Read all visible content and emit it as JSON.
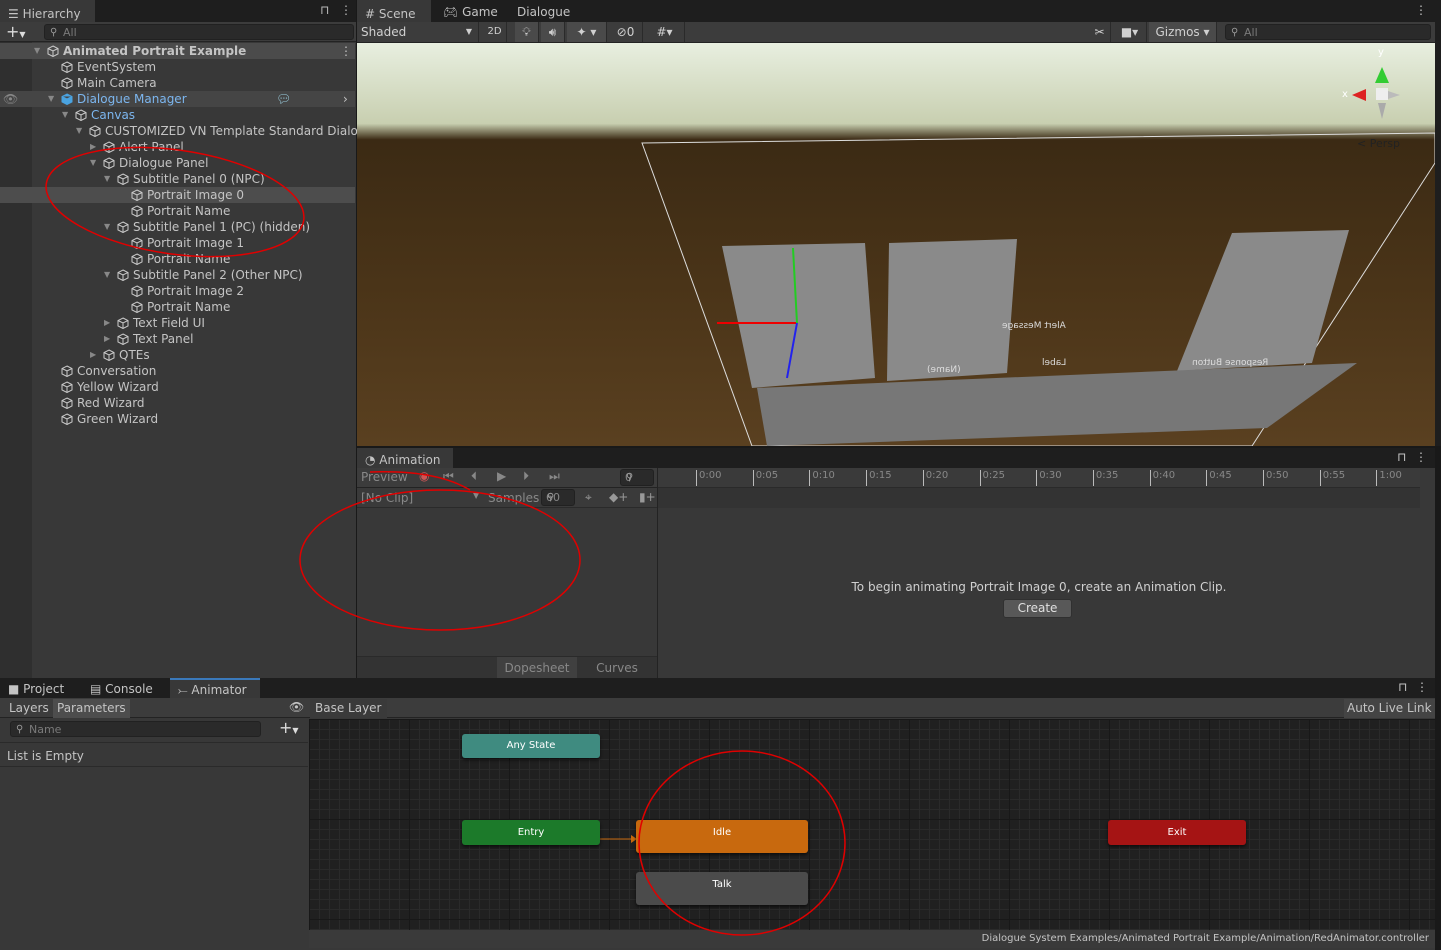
{
  "hierarchy": {
    "tab": "Hierarchy",
    "search_placeholder": "All",
    "items": [
      {
        "label": "Animated Portrait Example",
        "level": 0,
        "expanded": true,
        "icon": "unity-scene-icon"
      },
      {
        "label": "EventSystem",
        "level": 1,
        "icon": "gameobject-cube-icon"
      },
      {
        "label": "Main Camera",
        "level": 1,
        "icon": "gameobject-cube-icon"
      },
      {
        "label": "Dialogue Manager",
        "level": 1,
        "expanded": true,
        "icon": "prefab-cube-icon",
        "prefab": true
      },
      {
        "label": "Canvas",
        "level": 2,
        "expanded": true,
        "icon": "gameobject-cube-icon",
        "prefab": true
      },
      {
        "label": "CUSTOMIZED VN Template Standard Dialogue UI",
        "level": 3,
        "expanded": true,
        "icon": "gameobject-cube-icon"
      },
      {
        "label": "Alert Panel",
        "level": 4,
        "expanded": false,
        "icon": "gameobject-cube-icon"
      },
      {
        "label": "Dialogue Panel",
        "level": 4,
        "expanded": true,
        "icon": "gameobject-cube-icon"
      },
      {
        "label": "Subtitle Panel 0 (NPC)",
        "level": 5,
        "expanded": true,
        "icon": "gameobject-cube-icon"
      },
      {
        "label": "Portrait Image 0",
        "level": 6,
        "icon": "gameobject-cube-icon",
        "selected": true
      },
      {
        "label": "Portrait Name",
        "level": 6,
        "icon": "gameobject-cube-icon"
      },
      {
        "label": "Subtitle Panel 1 (PC) (hidden)",
        "level": 5,
        "expanded": true,
        "icon": "gameobject-cube-icon"
      },
      {
        "label": "Portrait Image 1",
        "level": 6,
        "icon": "gameobject-cube-icon"
      },
      {
        "label": "Portrait Name",
        "level": 6,
        "icon": "gameobject-cube-icon"
      },
      {
        "label": "Subtitle Panel 2 (Other NPC)",
        "level": 5,
        "expanded": true,
        "icon": "gameobject-cube-icon"
      },
      {
        "label": "Portrait Image 2",
        "level": 6,
        "icon": "gameobject-cube-icon"
      },
      {
        "label": "Portrait Name",
        "level": 6,
        "icon": "gameobject-cube-icon"
      },
      {
        "label": "Text Field UI",
        "level": 5,
        "expanded": false,
        "icon": "gameobject-cube-icon"
      },
      {
        "label": "Text Panel",
        "level": 5,
        "expanded": false,
        "icon": "gameobject-cube-icon"
      },
      {
        "label": "QTEs",
        "level": 4,
        "expanded": false,
        "icon": "gameobject-cube-icon"
      },
      {
        "label": "Conversation",
        "level": 1,
        "icon": "gameobject-cube-icon"
      },
      {
        "label": "Yellow Wizard",
        "level": 1,
        "icon": "gameobject-cube-icon"
      },
      {
        "label": "Red Wizard",
        "level": 1,
        "icon": "gameobject-cube-icon"
      },
      {
        "label": "Green Wizard",
        "level": 1,
        "icon": "gameobject-cube-icon"
      }
    ]
  },
  "scene": {
    "tabs": [
      "Scene",
      "Game",
      "Dialogue"
    ],
    "shading": "Shaded",
    "mode_2d": "2D",
    "hidden_count": "0",
    "gizmos": "Gizmos",
    "search_placeholder": "All",
    "projection": "Persp",
    "axis_x": "x",
    "axis_y": "y",
    "scene_labels": [
      "Alert Message",
      "Label",
      "(Name)",
      "Response Button"
    ]
  },
  "animation": {
    "tab": "Animation",
    "preview": "Preview",
    "frame": "0",
    "clip": "[No Clip]",
    "samples_label": "Samples",
    "samples": "60",
    "ticks": [
      "0:00",
      "0:05",
      "0:10",
      "0:15",
      "0:20",
      "0:25",
      "0:30",
      "0:35",
      "0:40",
      "0:45",
      "0:50",
      "0:55",
      "1:00"
    ],
    "message": "To begin animating Portrait Image 0, create an Animation Clip.",
    "create": "Create",
    "dopesheet": "Dopesheet",
    "curves": "Curves"
  },
  "bottom": {
    "tabs": [
      "Project",
      "Console",
      "Animator"
    ],
    "active_tab": "Animator"
  },
  "animator": {
    "layers": "Layers",
    "parameters": "Parameters",
    "name_placeholder": "Name",
    "list_empty": "List is Empty",
    "breadcrumb": "Base Layer",
    "auto_live_link": "Auto Live Link",
    "states": {
      "any_state": "Any State",
      "entry": "Entry",
      "idle": "Idle",
      "talk": "Talk",
      "exit": "Exit"
    },
    "colors": {
      "any_state": "#3f8b80",
      "entry": "#1c7a2a",
      "idle": "#c8690e",
      "talk": "#4b4b4b",
      "exit": "#a51414"
    },
    "status": "Dialogue System Examples/Animated Portrait Example/Animation/RedAnimator.controller"
  },
  "annotation_color": "#e00000"
}
